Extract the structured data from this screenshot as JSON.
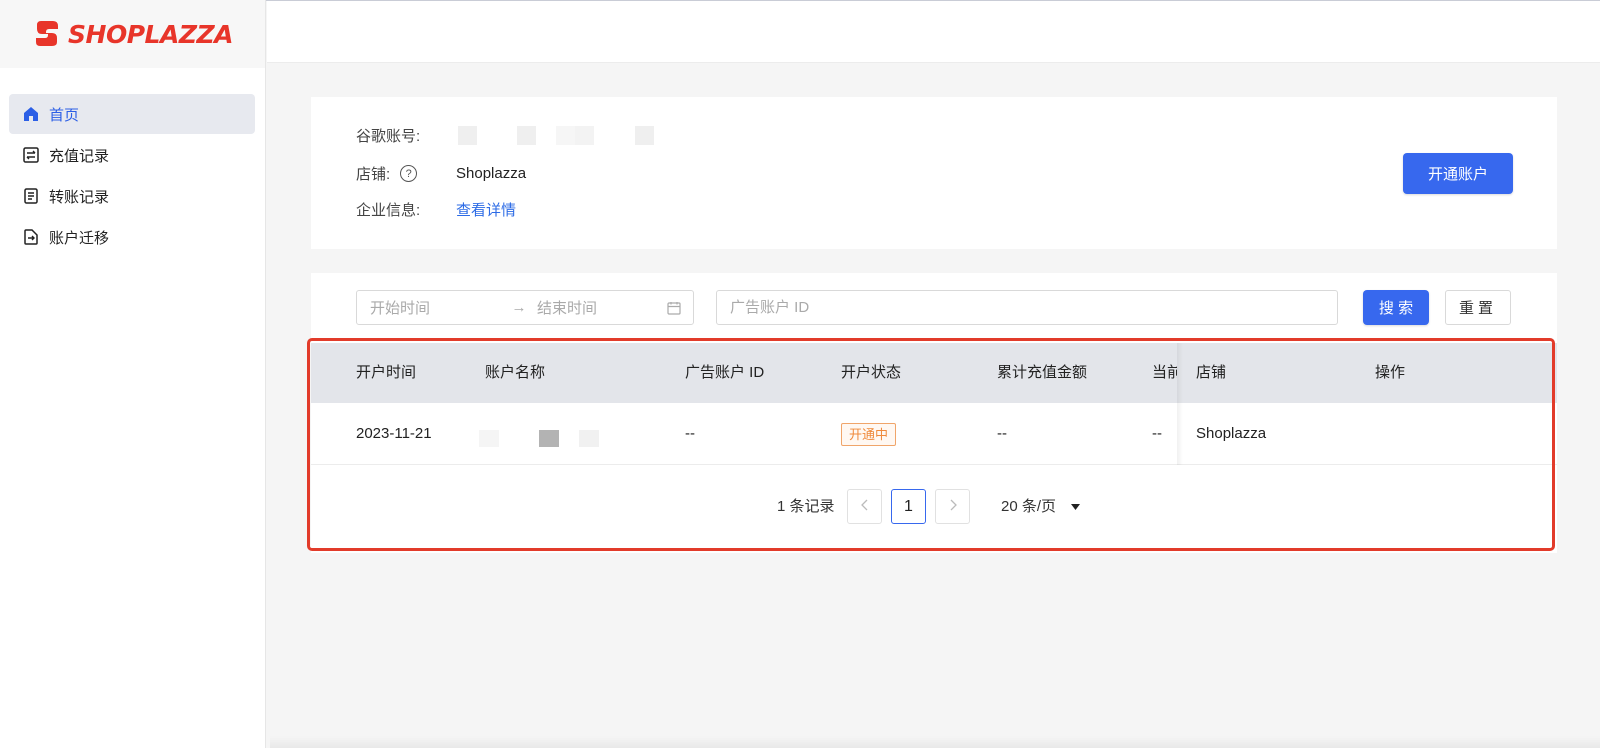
{
  "brand": {
    "name": "SHOPLAZZA",
    "color": "#e8352a"
  },
  "sidebar": {
    "items": [
      {
        "label": "首页",
        "icon": "home-icon",
        "active": true
      },
      {
        "label": "充值记录",
        "icon": "exchange-icon",
        "active": false
      },
      {
        "label": "转账记录",
        "icon": "document-icon",
        "active": false
      },
      {
        "label": "账户迁移",
        "icon": "migrate-icon",
        "active": false
      }
    ]
  },
  "info": {
    "google_account_label": "谷歌账号:",
    "store_label": "店铺:",
    "store_value": "Shoplazza",
    "company_label": "企业信息:",
    "company_link": "查看详情",
    "open_account_button": "开通账户"
  },
  "filters": {
    "start_placeholder": "开始时间",
    "end_placeholder": "结束时间",
    "ad_account_placeholder": "广告账户 ID",
    "search_button": "搜 索",
    "reset_button": "重置"
  },
  "table": {
    "columns": [
      "开户时间",
      "账户名称",
      "广告账户 ID",
      "开户状态",
      "累计充值金额",
      "当前",
      "店铺",
      "操作"
    ],
    "rows": [
      {
        "open_time": "2023-11-21",
        "account_name": "",
        "ad_account_id": "--",
        "status": "开通中",
        "total_recharge": "--",
        "current": "--",
        "store": "Shoplazza",
        "action": ""
      }
    ]
  },
  "pagination": {
    "total": "1 条记录",
    "current_page": "1",
    "page_size": "20 条/页"
  },
  "colors": {
    "primary": "#3768ee",
    "highlight_border": "#e23b2a",
    "status_tag": "#ef8a3c"
  }
}
